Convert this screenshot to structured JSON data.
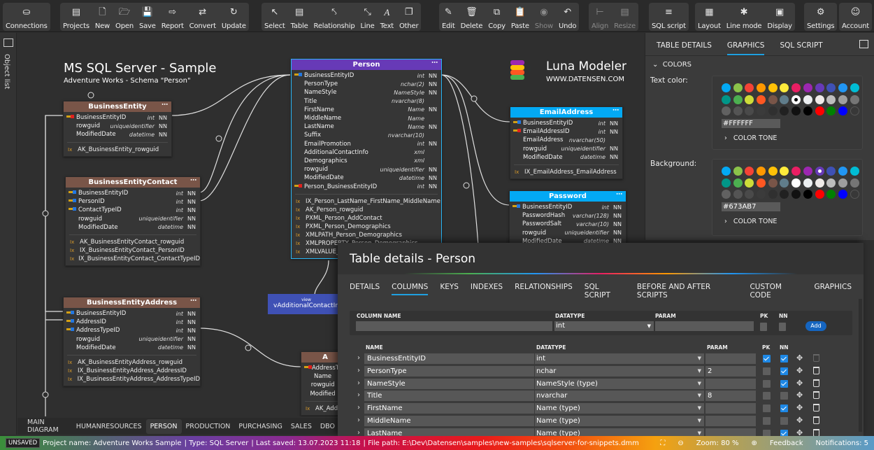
{
  "toolbar": {
    "groups": [
      [
        {
          "icon": "database-icon",
          "label": "Connections"
        }
      ],
      [
        {
          "icon": "projects-icon",
          "label": "Projects"
        },
        {
          "icon": "new-file-icon",
          "label": "New"
        },
        {
          "icon": "folder-open-icon",
          "label": "Open"
        },
        {
          "icon": "save-icon",
          "label": "Save"
        },
        {
          "icon": "report-icon",
          "label": "Report"
        },
        {
          "icon": "convert-icon",
          "label": "Convert"
        },
        {
          "icon": "update-icon",
          "label": "Update"
        }
      ],
      [
        {
          "icon": "cursor-icon",
          "label": "Select"
        },
        {
          "icon": "table-icon",
          "label": "Table"
        },
        {
          "icon": "relationship-icon",
          "label": "Relationship"
        },
        {
          "icon": "line-icon",
          "label": "Line"
        },
        {
          "icon": "text-icon",
          "label": "Text"
        },
        {
          "icon": "other-icon",
          "label": "Other"
        }
      ],
      [
        {
          "icon": "edit-icon",
          "label": "Edit"
        },
        {
          "icon": "trash-icon",
          "label": "Delete"
        },
        {
          "icon": "copy-icon",
          "label": "Copy"
        },
        {
          "icon": "paste-icon",
          "label": "Paste"
        },
        {
          "icon": "eye-icon",
          "label": "Show",
          "disabled": true
        },
        {
          "icon": "undo-icon",
          "label": "Undo"
        }
      ],
      [
        {
          "icon": "align-icon",
          "label": "Align",
          "disabled": true
        },
        {
          "icon": "resize-icon",
          "label": "Resize",
          "disabled": true
        }
      ],
      [
        {
          "icon": "sql-script-icon",
          "label": "SQL script"
        }
      ],
      [
        {
          "icon": "layout-icon",
          "label": "Layout"
        },
        {
          "icon": "line-mode-icon",
          "label": "Line mode"
        },
        {
          "icon": "display-icon",
          "label": "Display"
        }
      ],
      [
        {
          "icon": "gear-icon",
          "label": "Settings"
        }
      ],
      [
        {
          "icon": "user-icon",
          "label": "Account"
        }
      ]
    ]
  },
  "left_sidebar": {
    "label": "Object list"
  },
  "diagram": {
    "title": "MS SQL Server - Sample",
    "subtitle": "Adventure Works - Schema \"Person\"",
    "brand": "Luna Modeler",
    "brand_url": "WWW.DATENSEN.COM",
    "entities": {
      "business_entity": {
        "name": "BusinessEntity",
        "color": "#795548",
        "columns": [
          {
            "key": "pk",
            "name": "BusinessEntityID",
            "type": "int",
            "nn": "NN"
          },
          {
            "key": "",
            "name": "rowguid",
            "type": "uniqueidentifier",
            "nn": "NN"
          },
          {
            "key": "",
            "name": "ModifiedDate",
            "type": "datetime",
            "nn": "NN"
          }
        ],
        "indexes": [
          "AK_BusinessEntity_rowguid"
        ]
      },
      "business_entity_contact": {
        "name": "BusinessEntityContact",
        "color": "#795548",
        "columns": [
          {
            "key": "fk",
            "name": "BusinessEntityID",
            "type": "int",
            "nn": "NN"
          },
          {
            "key": "fk",
            "name": "PersonID",
            "type": "int",
            "nn": "NN"
          },
          {
            "key": "fk",
            "name": "ContactTypeID",
            "type": "int",
            "nn": "NN"
          },
          {
            "key": "",
            "name": "rowguid",
            "type": "uniqueidentifier",
            "nn": "NN"
          },
          {
            "key": "",
            "name": "ModifiedDate",
            "type": "datetime",
            "nn": "NN"
          }
        ],
        "indexes": [
          "AK_BusinessEntityContact_rowguid",
          "IX_BusinessEntityContact_PersonID",
          "IX_BusinessEntityContact_ContactTypeID"
        ]
      },
      "business_entity_address": {
        "name": "BusinessEntityAddress",
        "color": "#795548",
        "columns": [
          {
            "key": "fk",
            "name": "BusinessEntityID",
            "type": "int",
            "nn": "NN"
          },
          {
            "key": "fk",
            "name": "AddressID",
            "type": "int",
            "nn": "NN"
          },
          {
            "key": "fk",
            "name": "AddressTypeID",
            "type": "int",
            "nn": "NN"
          },
          {
            "key": "",
            "name": "rowguid",
            "type": "uniqueidentifier",
            "nn": "NN"
          },
          {
            "key": "",
            "name": "ModifiedDate",
            "type": "datetime",
            "nn": "NN"
          }
        ],
        "indexes": [
          "AK_BusinessEntityAddress_rowguid",
          "IX_BusinessEntityAddress_AddressID",
          "IX_BusinessEntityAddress_AddressTypeID"
        ]
      },
      "person": {
        "name": "Person",
        "color": "#673AB7",
        "columns": [
          {
            "key": "fk",
            "name": "BusinessEntityID",
            "type": "int",
            "nn": "NN"
          },
          {
            "key": "",
            "name": "PersonType",
            "type": "nchar(2)",
            "nn": "NN"
          },
          {
            "key": "",
            "name": "NameStyle",
            "type": "NameStyle",
            "nn": "NN"
          },
          {
            "key": "",
            "name": "Title",
            "type": "nvarchar(8)",
            "nn": ""
          },
          {
            "key": "",
            "name": "FirstName",
            "type": "Name",
            "nn": "NN"
          },
          {
            "key": "",
            "name": "MiddleName",
            "type": "Name",
            "nn": ""
          },
          {
            "key": "",
            "name": "LastName",
            "type": "Name",
            "nn": "NN"
          },
          {
            "key": "",
            "name": "Suffix",
            "type": "nvarchar(10)",
            "nn": ""
          },
          {
            "key": "",
            "name": "EmailPromotion",
            "type": "int",
            "nn": "NN"
          },
          {
            "key": "",
            "name": "AdditionalContactInfo",
            "type": "xml",
            "nn": ""
          },
          {
            "key": "",
            "name": "Demographics",
            "type": "xml",
            "nn": ""
          },
          {
            "key": "",
            "name": "rowguid",
            "type": "uniqueidentifier",
            "nn": "NN"
          },
          {
            "key": "",
            "name": "ModifiedDate",
            "type": "datetime",
            "nn": "NN"
          },
          {
            "key": "pk",
            "name": "Person_BusinessEntityID",
            "type": "int",
            "nn": "NN"
          }
        ],
        "indexes": [
          "IX_Person_LastName_FirstName_MiddleName",
          "AK_Person_rowguid",
          "PXML_Person_AddContact",
          "PXML_Person_Demographics",
          "XMLPATH_Person_Demographics",
          "XMLPROPERTY_Person_Demographics",
          "XMLVALUE_"
        ]
      },
      "email_address": {
        "name": "EmailAddress",
        "color": "#03A9F4",
        "columns": [
          {
            "key": "fk",
            "name": "BusinessEntityID",
            "type": "int",
            "nn": "NN"
          },
          {
            "key": "pk",
            "name": "EmailAddressID",
            "type": "int",
            "nn": "NN"
          },
          {
            "key": "",
            "name": "EmailAddress",
            "type": "nvarchar(50)",
            "nn": ""
          },
          {
            "key": "",
            "name": "rowguid",
            "type": "uniqueidentifier",
            "nn": "NN"
          },
          {
            "key": "",
            "name": "ModifiedDate",
            "type": "datetime",
            "nn": "NN"
          }
        ],
        "indexes": [
          "IX_EmailAddress_EmailAddress"
        ]
      },
      "password": {
        "name": "Password",
        "color": "#03A9F4",
        "columns": [
          {
            "key": "fk",
            "name": "BusinessEntityID",
            "type": "int",
            "nn": "NN"
          },
          {
            "key": "",
            "name": "PasswordHash",
            "type": "varchar(128)",
            "nn": "NN"
          },
          {
            "key": "",
            "name": "PasswordSalt",
            "type": "varchar(10)",
            "nn": "NN"
          },
          {
            "key": "",
            "name": "rowguid",
            "type": "uniqueidentifier",
            "nn": "NN"
          },
          {
            "key": "",
            "name": "ModifiedDate",
            "type": "datetime",
            "nn": "NN"
          }
        ],
        "indexes": []
      },
      "address_type": {
        "name": "A",
        "color": "#795548",
        "columns": [
          {
            "key": "pk",
            "name": "AddressT",
            "type": "",
            "nn": ""
          },
          {
            "key": "",
            "name": "Name",
            "type": "",
            "nn": ""
          },
          {
            "key": "",
            "name": "rowguid",
            "type": "",
            "nn": ""
          },
          {
            "key": "",
            "name": "Modified",
            "type": "",
            "nn": ""
          }
        ],
        "indexes": [
          "AK_Addr"
        ]
      }
    },
    "view": {
      "tag": "view",
      "name": "vAdditionalContactIn"
    }
  },
  "canvas_tabs": [
    {
      "label": "MAIN DIAGRAM"
    },
    {
      "label": "HUMANRESOURCES"
    },
    {
      "label": "PERSON",
      "active": true
    },
    {
      "label": "PRODUCTION"
    },
    {
      "label": "PURCHASING"
    },
    {
      "label": "SALES"
    },
    {
      "label": "DBO"
    }
  ],
  "right_panel": {
    "tabs": [
      {
        "label": "TABLE DETAILS"
      },
      {
        "label": "GRAPHICS",
        "active": true
      },
      {
        "label": "SQL SCRIPT"
      }
    ],
    "section": "COLORS",
    "text_color": {
      "label": "Text color:",
      "value": "#FFFFFF",
      "selected_index": 16
    },
    "background": {
      "label": "Background:",
      "value": "#673AB7",
      "selected_index": 8
    },
    "color_tone_label": "COLOR TONE",
    "palette": [
      "#03A9F4",
      "#8BC34A",
      "#F44336",
      "#FF9800",
      "#FFC107",
      "#FFEB3B",
      "#E91E63",
      "#9C27B0",
      "#673AB7",
      "#3F51B5",
      "#2196F3",
      "#00BCD4",
      "#009688",
      "#4CAF50",
      "#CDDC39",
      "#FF5722",
      "#795548",
      "#607D8B",
      "#FFFFFF",
      "#ECEFF1",
      "#EFEBE9",
      "#BDBDBD",
      "#9E9E9E",
      "#757575",
      "#616161",
      "#545454",
      "#4a4a4a",
      "#3b3b3b",
      "#303030",
      "#212121",
      "#111111",
      "#000000",
      "#FF0000",
      "#008000",
      "#0000FF",
      "transparent"
    ]
  },
  "dialog": {
    "title": "Table details - Person",
    "tabs": [
      {
        "label": "DETAILS"
      },
      {
        "label": "COLUMNS",
        "active": true
      },
      {
        "label": "KEYS"
      },
      {
        "label": "INDEXES"
      },
      {
        "label": "RELATIONSHIPS"
      },
      {
        "label": "SQL SCRIPT"
      },
      {
        "label": "BEFORE AND AFTER SCRIPTS"
      },
      {
        "label": "CUSTOM CODE"
      },
      {
        "label": "GRAPHICS"
      }
    ],
    "new_column": {
      "name_label": "COLUMN NAME",
      "name_value": "",
      "datatype_label": "DATATYPE",
      "datatype_value": "int",
      "param_label": "PARAM",
      "param_value": "",
      "pk_label": "PK",
      "nn_label": "NN",
      "add_label": "Add"
    },
    "grid_headers": {
      "name": "NAME",
      "datatype": "DATATYPE",
      "param": "PARAM",
      "pk": "PK",
      "nn": "NN"
    },
    "rows": [
      {
        "name": "BusinessEntityID",
        "datatype": "int",
        "param": "",
        "pk": true,
        "nn": true
      },
      {
        "name": "PersonType",
        "datatype": "nchar",
        "param": "2",
        "pk": false,
        "nn": true
      },
      {
        "name": "NameStyle",
        "datatype": "NameStyle (type)",
        "param": "",
        "pk": false,
        "nn": true
      },
      {
        "name": "Title",
        "datatype": "nvarchar",
        "param": "8",
        "pk": false,
        "nn": false
      },
      {
        "name": "FirstName",
        "datatype": "Name (type)",
        "param": "",
        "pk": false,
        "nn": true
      },
      {
        "name": "MiddleName",
        "datatype": "Name (type)",
        "param": "",
        "pk": false,
        "nn": false
      },
      {
        "name": "LastName",
        "datatype": "Name (type)",
        "param": "",
        "pk": false,
        "nn": true
      }
    ]
  },
  "status_bar": {
    "badge": "UNSAVED",
    "project": "Project name: Adventure Works Sample",
    "type": "| Type: SQL Server",
    "saved": "| Last saved: 13.07.2023 11:18",
    "path": "| File path: E:\\Dev\\Datensen\\samples\\new-samples\\sqlserver-for-snippets.dmm",
    "zoom": "Zoom: 80 %",
    "feedback": "Feedback",
    "notifications": "Notifications: 5"
  }
}
